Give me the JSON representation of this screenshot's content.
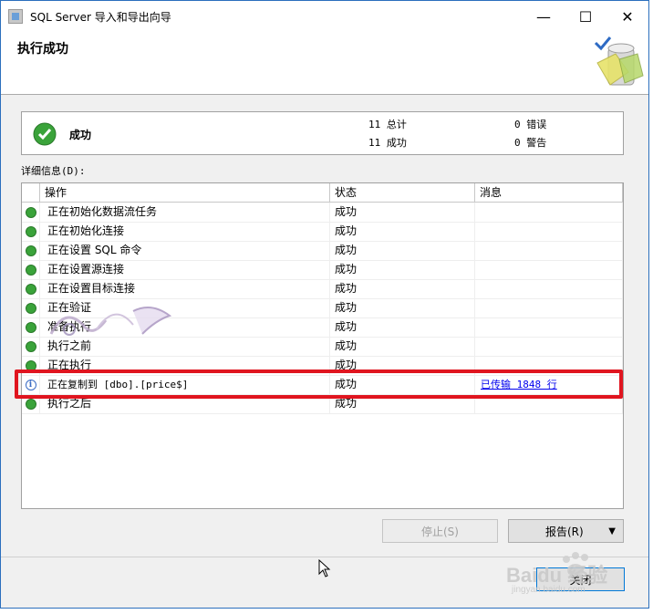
{
  "window": {
    "title": "SQL Server 导入和导出向导",
    "minimize_glyph": "—",
    "maximize_glyph": "☐",
    "close_glyph": "✕"
  },
  "header": {
    "page_title": "执行成功"
  },
  "summary": {
    "status_label": "成功",
    "total_label": "11 总计",
    "success_label": "11 成功",
    "error_label": "0 错误",
    "warning_label": "0 警告"
  },
  "details": {
    "label": "详细信息(D):",
    "columns": [
      "操作",
      "状态",
      "消息"
    ],
    "rows": [
      {
        "icon": "success",
        "action": "正在初始化数据流任务",
        "status": "成功",
        "message": ""
      },
      {
        "icon": "success",
        "action": "正在初始化连接",
        "status": "成功",
        "message": ""
      },
      {
        "icon": "success",
        "action": "正在设置 SQL 命令",
        "status": "成功",
        "message": ""
      },
      {
        "icon": "success",
        "action": "正在设置源连接",
        "status": "成功",
        "message": ""
      },
      {
        "icon": "success",
        "action": "正在设置目标连接",
        "status": "成功",
        "message": ""
      },
      {
        "icon": "success",
        "action": "正在验证",
        "status": "成功",
        "message": ""
      },
      {
        "icon": "success",
        "action": "准备执行",
        "status": "成功",
        "message": ""
      },
      {
        "icon": "success",
        "action": "执行之前",
        "status": "成功",
        "message": ""
      },
      {
        "icon": "success",
        "action": "正在执行",
        "status": "成功",
        "message": ""
      },
      {
        "icon": "info",
        "action": "正在复制到 [dbo].[price$]",
        "status": "成功",
        "message": "已传输 1848 行"
      },
      {
        "icon": "success",
        "action": "执行之后",
        "status": "成功",
        "message": ""
      }
    ]
  },
  "buttons": {
    "stop": "停止(S)",
    "report": "报告(R)",
    "close": "关闭"
  },
  "colors": {
    "highlight": "#e0151f",
    "success": "#3aa33a",
    "link": "#0000ee",
    "window_border": "#2b6fbd"
  },
  "watermark": {
    "text": "Baidu 经验",
    "subtext": "jingyan.baidu.com"
  }
}
